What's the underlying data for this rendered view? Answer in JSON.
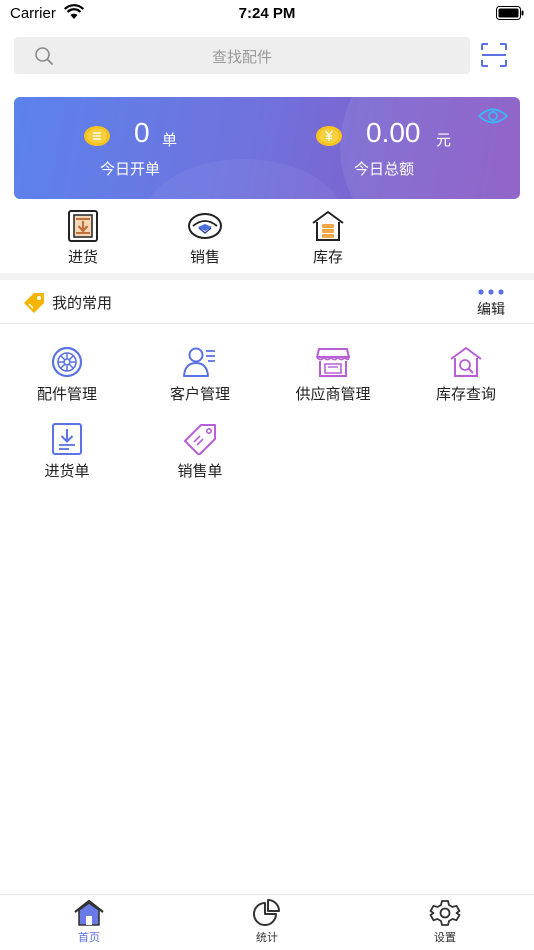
{
  "status_bar": {
    "carrier": "Carrier",
    "time": "7:24 PM"
  },
  "search": {
    "placeholder": "查找配件"
  },
  "summary": {
    "orders": {
      "value": "0",
      "unit": "单",
      "label": "今日开单"
    },
    "amount": {
      "value": "0.00",
      "unit": "元",
      "label": "今日总额"
    }
  },
  "quick_actions": [
    {
      "label": "进货",
      "icon": "purchase-icon"
    },
    {
      "label": "销售",
      "icon": "sales-icon"
    },
    {
      "label": "库存",
      "icon": "inventory-icon"
    }
  ],
  "favorites": {
    "title": "我的常用",
    "edit_label": "编辑",
    "items": [
      {
        "label": "配件管理",
        "icon": "wheel-icon"
      },
      {
        "label": "客户管理",
        "icon": "customer-icon"
      },
      {
        "label": "供应商管理",
        "icon": "store-icon"
      },
      {
        "label": "库存查询",
        "icon": "warehouse-search-icon"
      },
      {
        "label": "进货单",
        "icon": "purchase-order-icon"
      },
      {
        "label": "销售单",
        "icon": "price-tag-icon"
      }
    ]
  },
  "tabs": [
    {
      "label": "首页",
      "icon": "home-icon",
      "active": true
    },
    {
      "label": "统计",
      "icon": "pie-chart-icon",
      "active": false
    },
    {
      "label": "设置",
      "icon": "gear-icon",
      "active": false
    }
  ],
  "colors": {
    "accent": "#5b6fe0",
    "card_gradient_start": "#5c82ec",
    "card_gradient_end": "#8a58c4",
    "coin": "#f5c21b",
    "tag": "#f4b400",
    "icon_blue": "#5b72e6",
    "icon_purple": "#b85ed8"
  }
}
